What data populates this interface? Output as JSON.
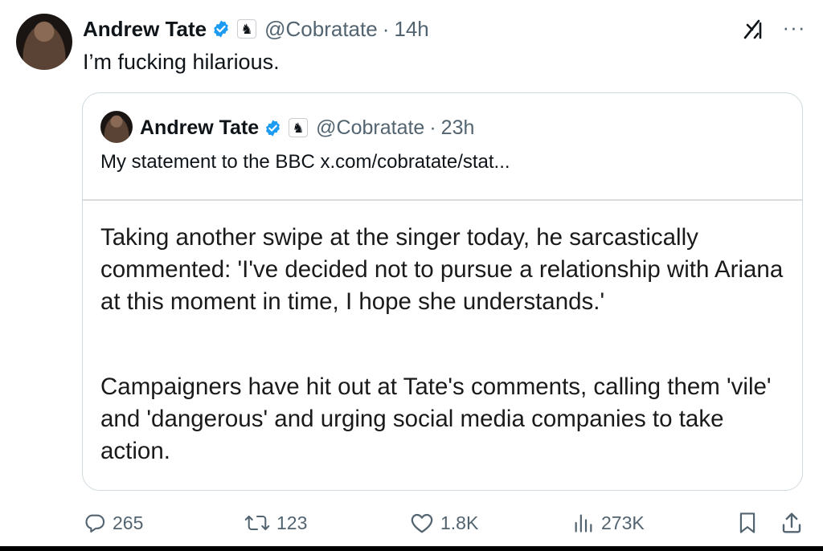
{
  "tweet": {
    "author_name": "Andrew Tate",
    "handle": "@Cobratate",
    "separator": "·",
    "time": "14h",
    "text": "I’m fucking hilarious.",
    "more_label": "···"
  },
  "quote": {
    "author_name": "Andrew Tate",
    "handle": "@Cobratate",
    "separator": "·",
    "time": "23h",
    "text": "My statement to the BBC  x.com/cobratate/stat...",
    "media_paragraphs": [
      "Taking another swipe at the singer today, he sarcastically commented: 'I've decided not to pursue a relationship with Ariana at this moment in time, I hope she understands.'",
      "Campaigners have hit out at Tate's comments, calling them 'vile' and 'dangerous' and urging social media companies to take action."
    ]
  },
  "actions": {
    "replies": "265",
    "reposts": "123",
    "likes": "1.8K",
    "views": "273K"
  },
  "icons": {
    "verified": "verified-badge-icon",
    "affiliate": "chess-knight-icon",
    "grok": "grok-icon",
    "reply": "reply-icon",
    "repost": "repost-icon",
    "like": "heart-icon",
    "views": "views-icon",
    "bookmark": "bookmark-icon",
    "share": "share-icon"
  },
  "colors": {
    "verified_blue": "#1d9bf0",
    "secondary_text": "#536471",
    "primary_text": "#0f1419",
    "border": "#cfd9de"
  }
}
